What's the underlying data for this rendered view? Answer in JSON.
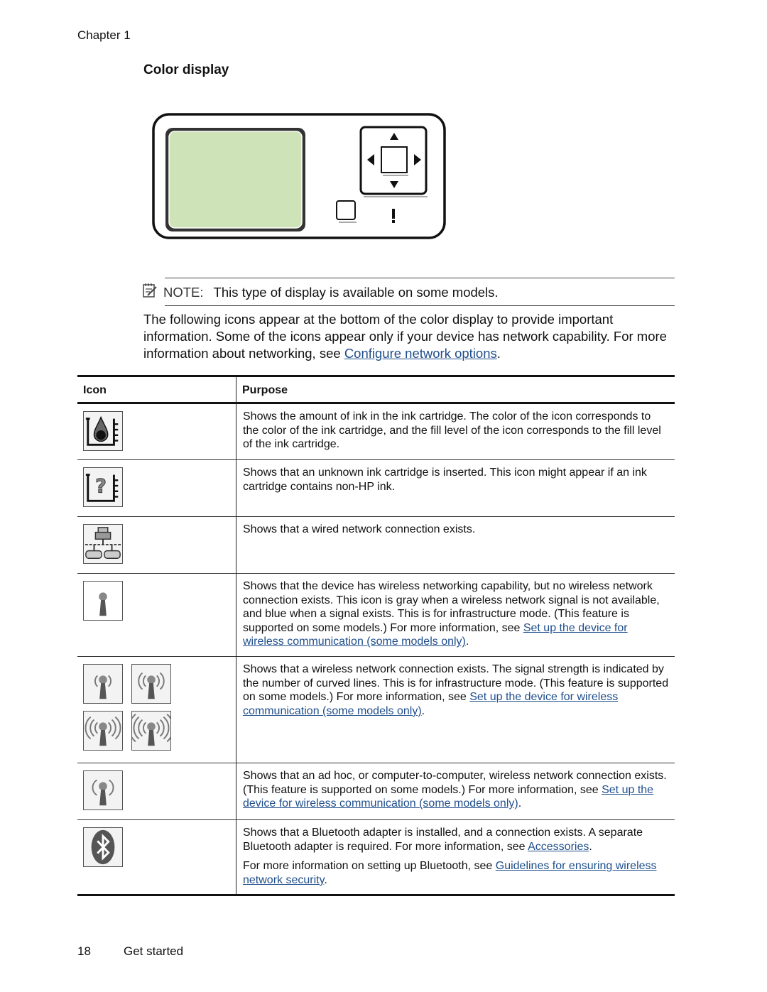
{
  "header": {
    "chapter": "Chapter 1"
  },
  "section": {
    "title": "Color display"
  },
  "panel": {
    "screen_color": "#cfe3b9",
    "icons": [
      "arrow-up-icon",
      "arrow-down-icon",
      "arrow-left-icon",
      "arrow-right-icon",
      "ok-button-icon",
      "cancel-button-icon",
      "attention-icon"
    ]
  },
  "note": {
    "label": "NOTE:",
    "text": "This type of display is available on some models."
  },
  "intro": {
    "text": "The following icons appear at the bottom of the color display to provide important information. Some of the icons appear only if your device has network capability. For more information about networking, see ",
    "link": "Configure network options",
    "after": "."
  },
  "table": {
    "headers": {
      "icon": "Icon",
      "purpose": "Purpose"
    },
    "rows": [
      {
        "icon": "ink-level-icon",
        "text": "Shows the amount of ink in the ink cartridge. The color of the icon corresponds to the color of the ink cartridge, and the fill level of the icon corresponds to the fill level of the ink cartridge."
      },
      {
        "icon": "unknown-cartridge-icon",
        "text": "Shows that an unknown ink cartridge is inserted. This icon might appear if an ink cartridge contains non-HP ink."
      },
      {
        "icon": "wired-network-icon",
        "text": "Shows that a wired network connection exists."
      },
      {
        "icon": "wireless-no-connection-icon",
        "text": "Shows that the device has wireless networking capability, but no wireless network connection exists. This icon is gray when a wireless network signal is not available, and blue when a signal exists. This is for infrastructure mode. (This feature is supported on some models.) For more information, see ",
        "link": "Set up the device for wireless communication (some models only)",
        "after": "."
      },
      {
        "icon": "wireless-signal-strength-icons",
        "text": "Shows that a wireless network connection exists. The signal strength is indicated by the number of curved lines. This is for infrastructure mode. (This feature is supported on some models.) For more information, see ",
        "link": "Set up the device for wireless communication (some models only)",
        "after": "."
      },
      {
        "icon": "wireless-ad-hoc-icon",
        "text": "Shows that an ad hoc, or computer-to-computer, wireless network connection exists. (This feature is supported on some models.) For more information, see ",
        "link": "Set up the device for wireless communication (some models only)",
        "after": "."
      },
      {
        "icon": "bluetooth-icon",
        "text": "Shows that a Bluetooth adapter is installed, and a connection exists. A separate Bluetooth adapter is required. For more information, see ",
        "link": "Accessories",
        "after": ".",
        "text2": "For more information on setting up Bluetooth, see ",
        "link2": "Guidelines for ensuring wireless network security",
        "after2": "."
      }
    ]
  },
  "footer": {
    "page_number": "18",
    "title": "Get started"
  }
}
